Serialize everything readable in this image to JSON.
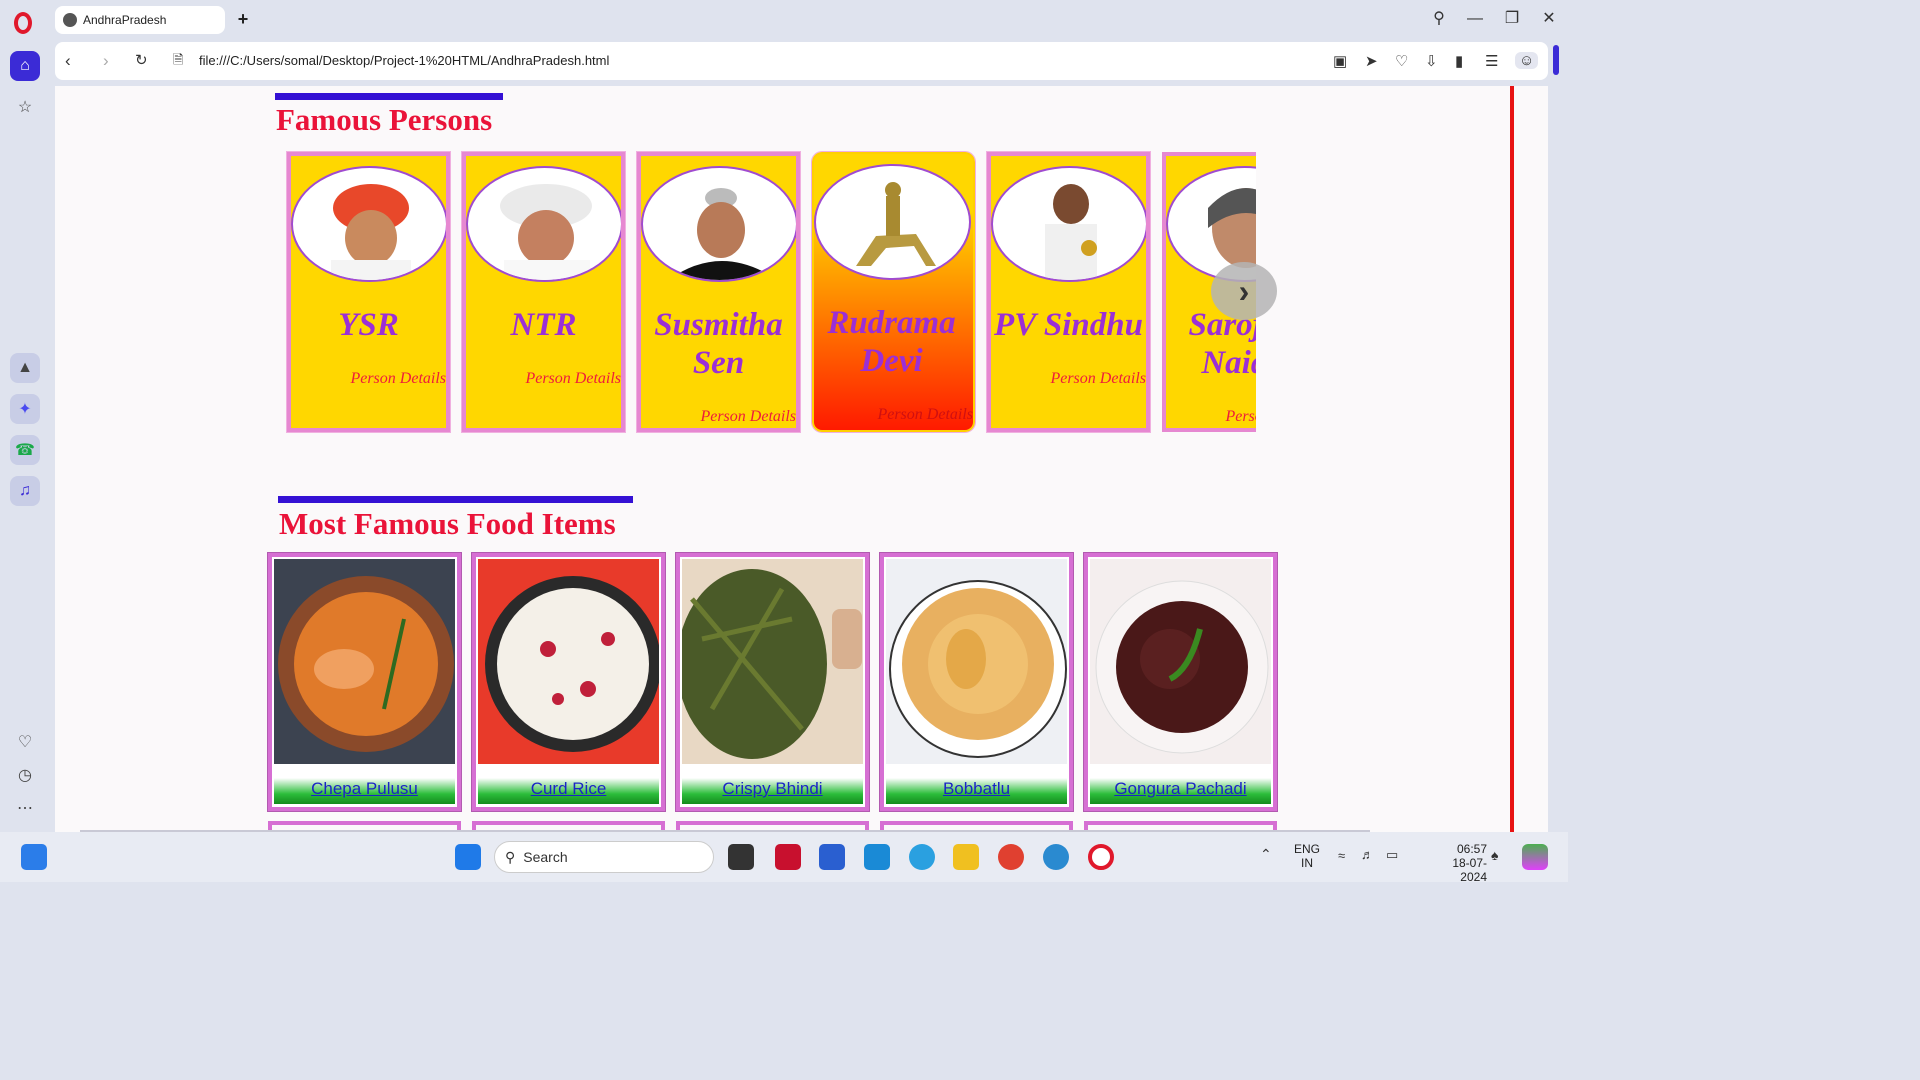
{
  "browser": {
    "tab_title": "AndhraPradesh",
    "url": "file:///C:/Users/somal/Desktop/Project-1%20HTML/AndhraPradesh.html"
  },
  "section_persons": {
    "title": "Famous Persons",
    "persons": [
      {
        "name": "YSR",
        "details": "Person Details"
      },
      {
        "name": "NTR",
        "details": "Person Details"
      },
      {
        "name": "Susmitha Sen",
        "details": "Person Details"
      },
      {
        "name": "Rudrama Devi",
        "details": "Person Details"
      },
      {
        "name": "PV Sindhu",
        "details": "Person Details"
      },
      {
        "name": "Sarojini Naidu",
        "details": "Person Details"
      }
    ],
    "next_icon": "chevron-right-icon"
  },
  "section_food": {
    "title": "Most Famous Food Items",
    "items": [
      {
        "name": "Chepa Pulusu"
      },
      {
        "name": "Curd Rice"
      },
      {
        "name": "Crispy Bhindi"
      },
      {
        "name": "Bobbatlu"
      },
      {
        "name": "Gongura Pachadi"
      }
    ]
  },
  "taskbar": {
    "search_placeholder": "Search",
    "lang_top": "ENG",
    "lang_bottom": "IN",
    "time": "06:57",
    "date": "18-07-2024"
  },
  "colors": {
    "accent": "#3411d4",
    "heading": "#ea1339",
    "card": "#ffd700",
    "name": "#9b2fd6"
  }
}
